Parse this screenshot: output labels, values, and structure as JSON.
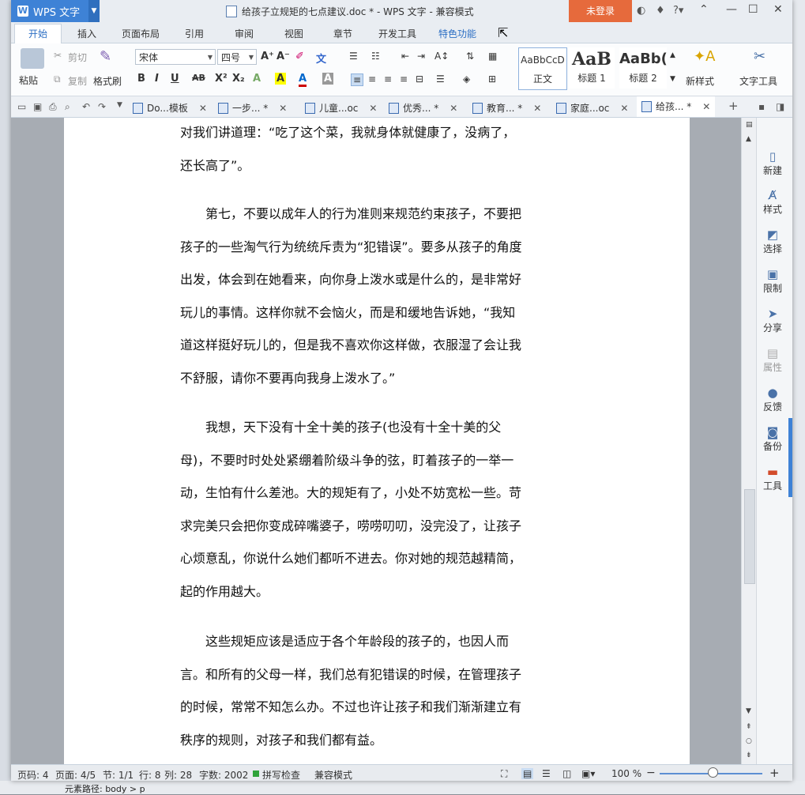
{
  "titlebar": {
    "app_name": "WPS 文字",
    "doc_title": "给孩子立规矩的七点建议.doc * - WPS 文字 - 兼容模式",
    "login": "未登录"
  },
  "menu_tabs": [
    "开始",
    "插入",
    "页面布局",
    "引用",
    "审阅",
    "视图",
    "章节",
    "开发工具",
    "特色功能"
  ],
  "ribbon": {
    "paste": "粘贴",
    "cut": "剪切",
    "copy": "复制",
    "format_painter": "格式刷",
    "font_name": "宋体",
    "font_size": "四号",
    "styles": [
      {
        "sample": "AaBbCcD",
        "label": "正文"
      },
      {
        "sample": "AaB",
        "label": "标题 1"
      },
      {
        "sample": "AaBb(",
        "label": "标题 2"
      }
    ],
    "new_style": "新样式",
    "text_tools": "文字工具"
  },
  "doc_tabs": [
    {
      "label": "Do...模板"
    },
    {
      "label": "一步... *"
    },
    {
      "label": "儿童...oc"
    },
    {
      "label": "优秀... *"
    },
    {
      "label": "教育... *"
    },
    {
      "label": "家庭...oc"
    },
    {
      "label": "给孩... *"
    }
  ],
  "document": {
    "lines": [
      "对我们讲道理：“吃了这个菜，我就身体就健康了，没病了，",
      "还长高了”。",
      "　　第七，不要以成年人的行为准则来规范约束孩子，不要把",
      "孩子的一些淘气行为统统斥责为“犯错误”。要多从孩子的角度",
      "出发，体会到在她看来，向你身上泼水或是什么的，是非常好",
      "玩儿的事情。这样你就不会恼火，而是和缓地告诉她，“我知",
      "道这样挺好玩儿的，但是我不喜欢你这样做，衣服湿了会让我",
      "不舒服，请你不要再向我身上泼水了。”",
      "　　我想，天下没有十全十美的孩子(也没有十全十美的父",
      "母)，不要时时处处紧绷着阶级斗争的弦，盯着孩子的一举一",
      "动，生怕有什么差池。大的规矩有了，小处不妨宽松一些。苛",
      "求完美只会把你变成碎嘴婆子，唠唠叨叨，没完没了，让孩子",
      "心烦意乱，你说什么她们都听不进去。你对她的规范越精简，",
      "起的作用越大。",
      "　　这些规矩应该是适应于各个年龄段的孩子的，也因人而",
      "言。和所有的父母一样，我们总有犯错误的时候，在管理孩子",
      "的时候，常常不知怎么办。不过也许让孩子和我们渐渐建立有",
      "秩序的规则，对孩子和我们都有益。"
    ]
  },
  "sidepane": [
    "新建",
    "样式",
    "选择",
    "限制",
    "分享",
    "属性",
    "反馈",
    "备份",
    "工具"
  ],
  "status": {
    "page_num": "页码: 4",
    "pages": "页面: 4/5",
    "section": "节: 1/1",
    "row": "行: 8",
    "col": "列: 28",
    "words": "字数: 2002",
    "spell": "拼写检查",
    "mode": "兼容模式",
    "zoom": "100 %"
  },
  "bottom_strip": "元素路径: body > p",
  "colors": {
    "accent": "#3e82d6",
    "login": "#e66a3c"
  }
}
